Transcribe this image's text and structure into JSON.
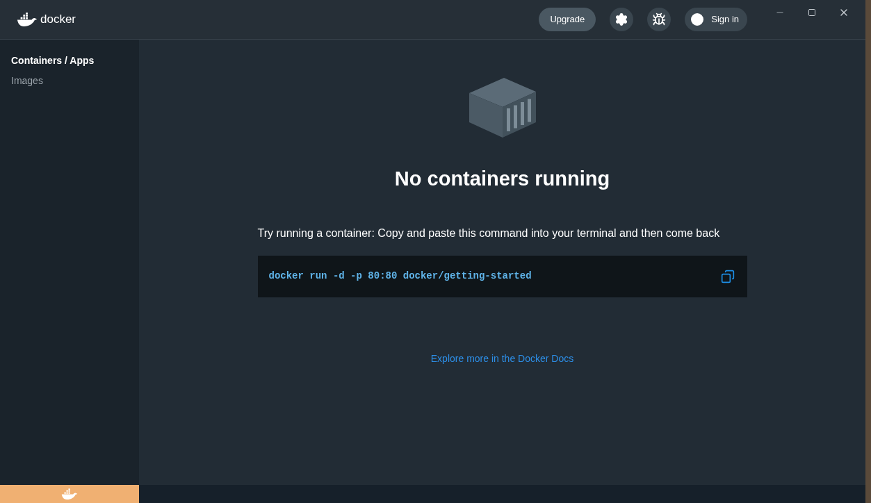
{
  "header": {
    "logo_text": "docker",
    "upgrade_button": "Upgrade",
    "sign_in_button": "Sign in"
  },
  "sidebar": {
    "items": [
      {
        "label": "Containers / Apps",
        "selected": true
      },
      {
        "label": "Images",
        "selected": false
      }
    ]
  },
  "main": {
    "title": "No containers running",
    "instruction": "Try running a container: Copy and paste this command into your terminal and then come back",
    "command": "docker run -d -p 80:80 docker/getting-started",
    "docs_link": "Explore more in the Docker Docs"
  }
}
